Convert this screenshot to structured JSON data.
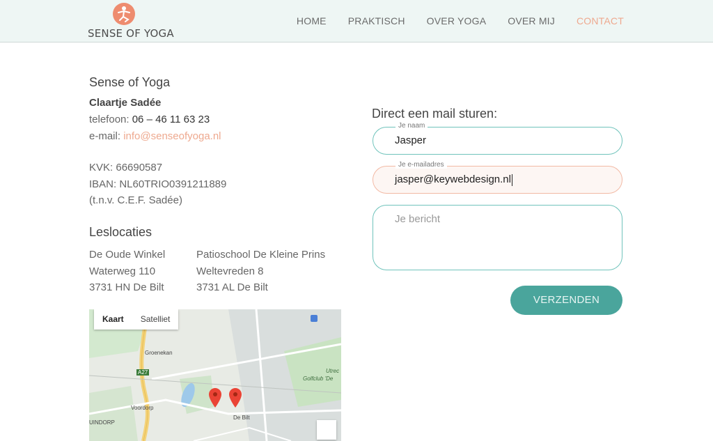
{
  "header": {
    "logo_text": "SENSE OF YOGA",
    "nav": [
      {
        "label": "HOME"
      },
      {
        "label": "PRAKTISCH"
      },
      {
        "label": "OVER YOGA"
      },
      {
        "label": "OVER MIJ"
      },
      {
        "label": "CONTACT",
        "active": true
      }
    ]
  },
  "contact": {
    "company": "Sense of Yoga",
    "name": "Claartje Sadée",
    "phone_label": "telefoon: ",
    "phone": "06 – 46 11 63 23",
    "email_label": "e-mail: ",
    "email": "info@senseofyoga.nl",
    "kvk": "KVK: 66690587",
    "iban": "IBAN: NL60TRIO0391211889",
    "tnv": "(t.n.v. C.E.F. Sadée)"
  },
  "locations": {
    "title": "Leslocaties",
    "items": [
      {
        "name": "De Oude Winkel",
        "street": "Waterweg 110",
        "city": "3731 HN De Bilt"
      },
      {
        "name": "Patioschool De Kleine Prins",
        "street": "Weltevreden 8",
        "city": "3731 AL De Bilt"
      }
    ]
  },
  "map": {
    "tab_map": "Kaart",
    "tab_satellite": "Satelliet",
    "labels": {
      "groenekan": "Groenekan",
      "voordorp": "Voordorp",
      "debilt": "De Bilt",
      "uindorp": "UINDORP",
      "golfclub": "Golfclub 'De",
      "utrec": "Utrec",
      "a27": "A27"
    }
  },
  "form": {
    "title": "Direct een mail sturen:",
    "name_label": "Je naam",
    "name_value": "Jasper",
    "email_label": "Je e-mailadres",
    "email_value": "jasper@keywebdesign.nl",
    "message_placeholder": "Je bericht",
    "submit": "VERZENDEN"
  },
  "colors": {
    "accent": "#eea98f",
    "teal": "#4aa59c",
    "header_bg": "#eef6f4"
  }
}
